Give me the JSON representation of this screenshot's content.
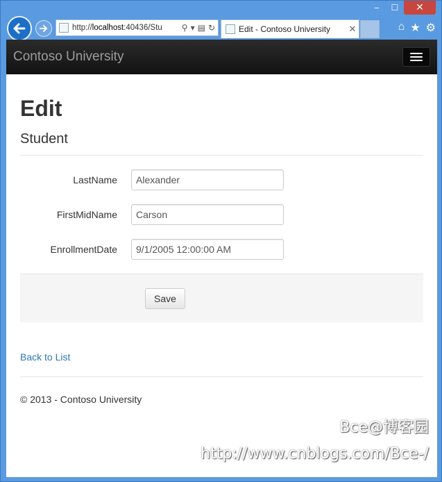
{
  "browser": {
    "url_prefix": "http://",
    "url_host": "localhost",
    "url_rest": ":40436/Stu",
    "tab_title": "Edit - Contoso University",
    "tab_close": "✕",
    "window_controls": {
      "minimize": "‒",
      "maximize": "☐",
      "close": "✕"
    },
    "icons": [
      "home-icon",
      "star-icon",
      "gear-icon"
    ]
  },
  "site": {
    "brand": "Contoso University"
  },
  "page": {
    "title": "Edit",
    "subtitle": "Student",
    "fields": [
      {
        "label": "LastName",
        "value": "Alexander"
      },
      {
        "label": "FirstMidName",
        "value": "Carson"
      },
      {
        "label": "EnrollmentDate",
        "value": "9/1/2005 12:00:00 AM"
      }
    ],
    "save_label": "Save",
    "back_link": "Back to List",
    "footer": "© 2013 - Contoso University"
  },
  "watermark": {
    "line1": "Bce@博客园",
    "line2": "http://www.cnblogs.com/Bce-/"
  },
  "colors": {
    "navbar": "#222222",
    "link": "#2a7ab0",
    "chrome": "#5a9ae0"
  }
}
